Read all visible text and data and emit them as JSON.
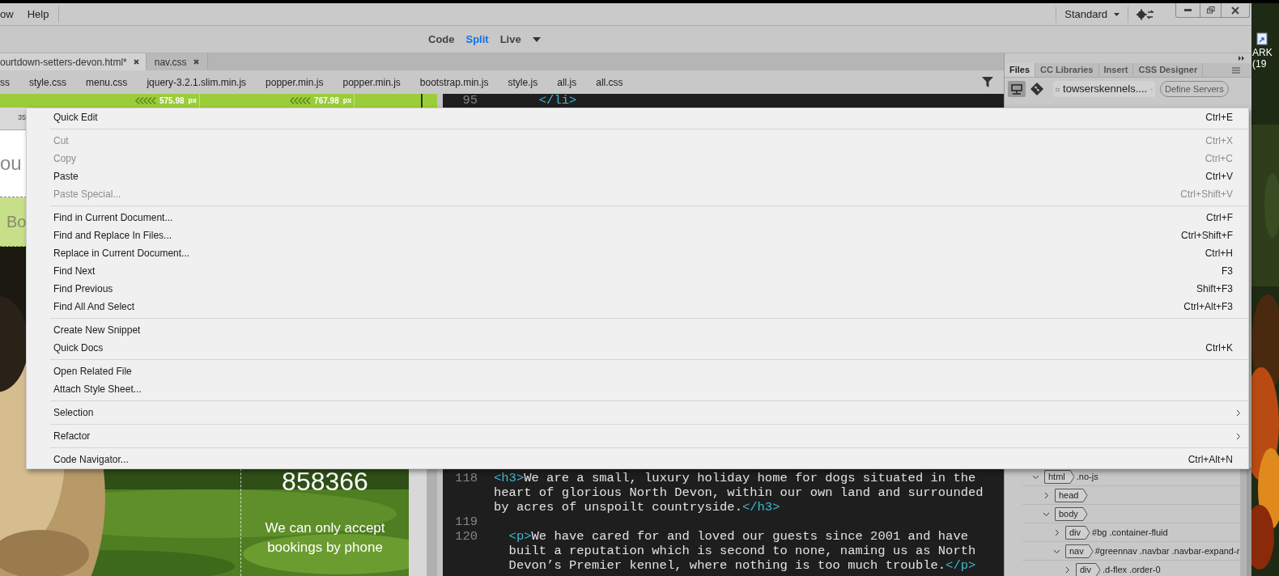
{
  "menu_bar": {
    "items": [
      "ow",
      "Help"
    ],
    "workspace": "Standard"
  },
  "view_modes": [
    {
      "label": "Code",
      "selected": false
    },
    {
      "label": "Split",
      "selected": true
    },
    {
      "label": "Live",
      "selected": false
    }
  ],
  "document_tabs": [
    {
      "label": "ourtdown-setters-devon.html*",
      "selected": true
    },
    {
      "label": "nav.css",
      "selected": false
    }
  ],
  "related_files": [
    "ss",
    "style.css",
    "menu.css",
    "jquery-3.2.1.slim.min.js",
    "popper.min.js",
    "popper.min.js",
    "bootstrap.min.js",
    "style.js",
    "all.js",
    "all.css"
  ],
  "media_queries": [
    {
      "value": "575.98",
      "unit": "px"
    },
    {
      "value": "767.98",
      "unit": "px"
    }
  ],
  "design_view": {
    "ruler_label": "35",
    "header_text": "ou",
    "nav_text": "Bo",
    "phone": "858366",
    "notice": "We can only accept bookings by phone"
  },
  "code_view": {
    "top_lines": [
      {
        "number": "95",
        "segments": [
          {
            "kind": "tag",
            "text": "      </li>"
          }
        ]
      }
    ],
    "lines": [
      {
        "number": "118",
        "segments": [
          {
            "kind": "tag",
            "text": "<h3>"
          },
          {
            "kind": "text",
            "text": "We are a small, luxury holiday home for dogs situated in the heart of glorious North Devon, within our own land and surrounded by acres of unspoilt countryside."
          },
          {
            "kind": "tag",
            "text": "</h3>"
          }
        ]
      },
      {
        "number": "119"
      },
      {
        "number": "120",
        "segments": [
          {
            "kind": "tag",
            "text": "  <p>"
          },
          {
            "kind": "text",
            "text": "We have cared for and loved our guests since 2001 and have built a reputation which is second to none, naming us as North Devon’s Premier kennel, where nothing is too much trouble."
          },
          {
            "kind": "tag",
            "text": "</p>"
          }
        ]
      }
    ]
  },
  "panel": {
    "tabs": [
      {
        "label": "Files",
        "selected": true
      },
      {
        "label": "CC Libraries",
        "selected": false
      },
      {
        "label": "Insert",
        "selected": false
      },
      {
        "label": "CSS Designer",
        "selected": false
      }
    ],
    "site": "towserskennels....",
    "define_servers": "Define Servers",
    "dom_tree": [
      {
        "tag": "html",
        "attrs": ".no-js",
        "expanded": true,
        "children": [
          {
            "tag": "head",
            "expanded": false
          },
          {
            "tag": "body",
            "expanded": true,
            "children": [
              {
                "tag": "div",
                "attrs": "#bg .container-fluid",
                "expanded": false
              },
              {
                "tag": "nav",
                "attrs": "#greennav .navbar .navbar-expand-r",
                "expanded": true,
                "children": [
                  {
                    "tag": "div",
                    "attrs": ".d-flex .order-0",
                    "expanded": false
                  }
                ]
              }
            ]
          }
        ]
      }
    ]
  },
  "context_menu": {
    "groups": [
      {
        "items": [
          {
            "label": "Quick Edit",
            "shortcut": "Ctrl+E",
            "disabled": false,
            "has_submenu": false
          }
        ]
      },
      {
        "items": [
          {
            "label": "Cut",
            "shortcut": "Ctrl+X",
            "disabled": true,
            "has_submenu": false
          },
          {
            "label": "Copy",
            "shortcut": "Ctrl+C",
            "disabled": true,
            "has_submenu": false
          },
          {
            "label": "Paste",
            "shortcut": "Ctrl+V",
            "disabled": false,
            "has_submenu": false
          },
          {
            "label": "Paste Special...",
            "shortcut": "Ctrl+Shift+V",
            "disabled": true,
            "has_submenu": false
          }
        ]
      },
      {
        "items": [
          {
            "label": "Find in Current Document...",
            "shortcut": "Ctrl+F",
            "disabled": false,
            "has_submenu": false
          },
          {
            "label": "Find and Replace In Files...",
            "shortcut": "Ctrl+Shift+F",
            "disabled": false,
            "has_submenu": false
          },
          {
            "label": "Replace in Current Document...",
            "shortcut": "Ctrl+H",
            "disabled": false,
            "has_submenu": false
          },
          {
            "label": "Find Next",
            "shortcut": "F3",
            "disabled": false,
            "has_submenu": false
          },
          {
            "label": "Find Previous",
            "shortcut": "Shift+F3",
            "disabled": false,
            "has_submenu": false
          },
          {
            "label": "Find All And Select",
            "shortcut": "Ctrl+Alt+F3",
            "disabled": false,
            "has_submenu": false
          }
        ]
      },
      {
        "items": [
          {
            "label": "Create New Snippet",
            "disabled": false,
            "has_submenu": false
          },
          {
            "label": "Quick Docs",
            "shortcut": "Ctrl+K",
            "disabled": false,
            "has_submenu": false
          }
        ]
      },
      {
        "items": [
          {
            "label": "Open Related File",
            "disabled": false,
            "has_submenu": false
          },
          {
            "label": "Attach Style Sheet...",
            "disabled": false,
            "has_submenu": false
          }
        ]
      },
      {
        "items": [
          {
            "label": "Selection",
            "disabled": false,
            "has_submenu": true
          }
        ]
      },
      {
        "items": [
          {
            "label": "Refactor",
            "disabled": false,
            "has_submenu": true
          }
        ]
      },
      {
        "items": [
          {
            "label": "Code Navigator...",
            "shortcut": "Ctrl+Alt+N",
            "disabled": false,
            "has_submenu": false
          }
        ]
      }
    ]
  },
  "desktop": {
    "icon_label": [
      "ARK",
      "(19"
    ]
  }
}
